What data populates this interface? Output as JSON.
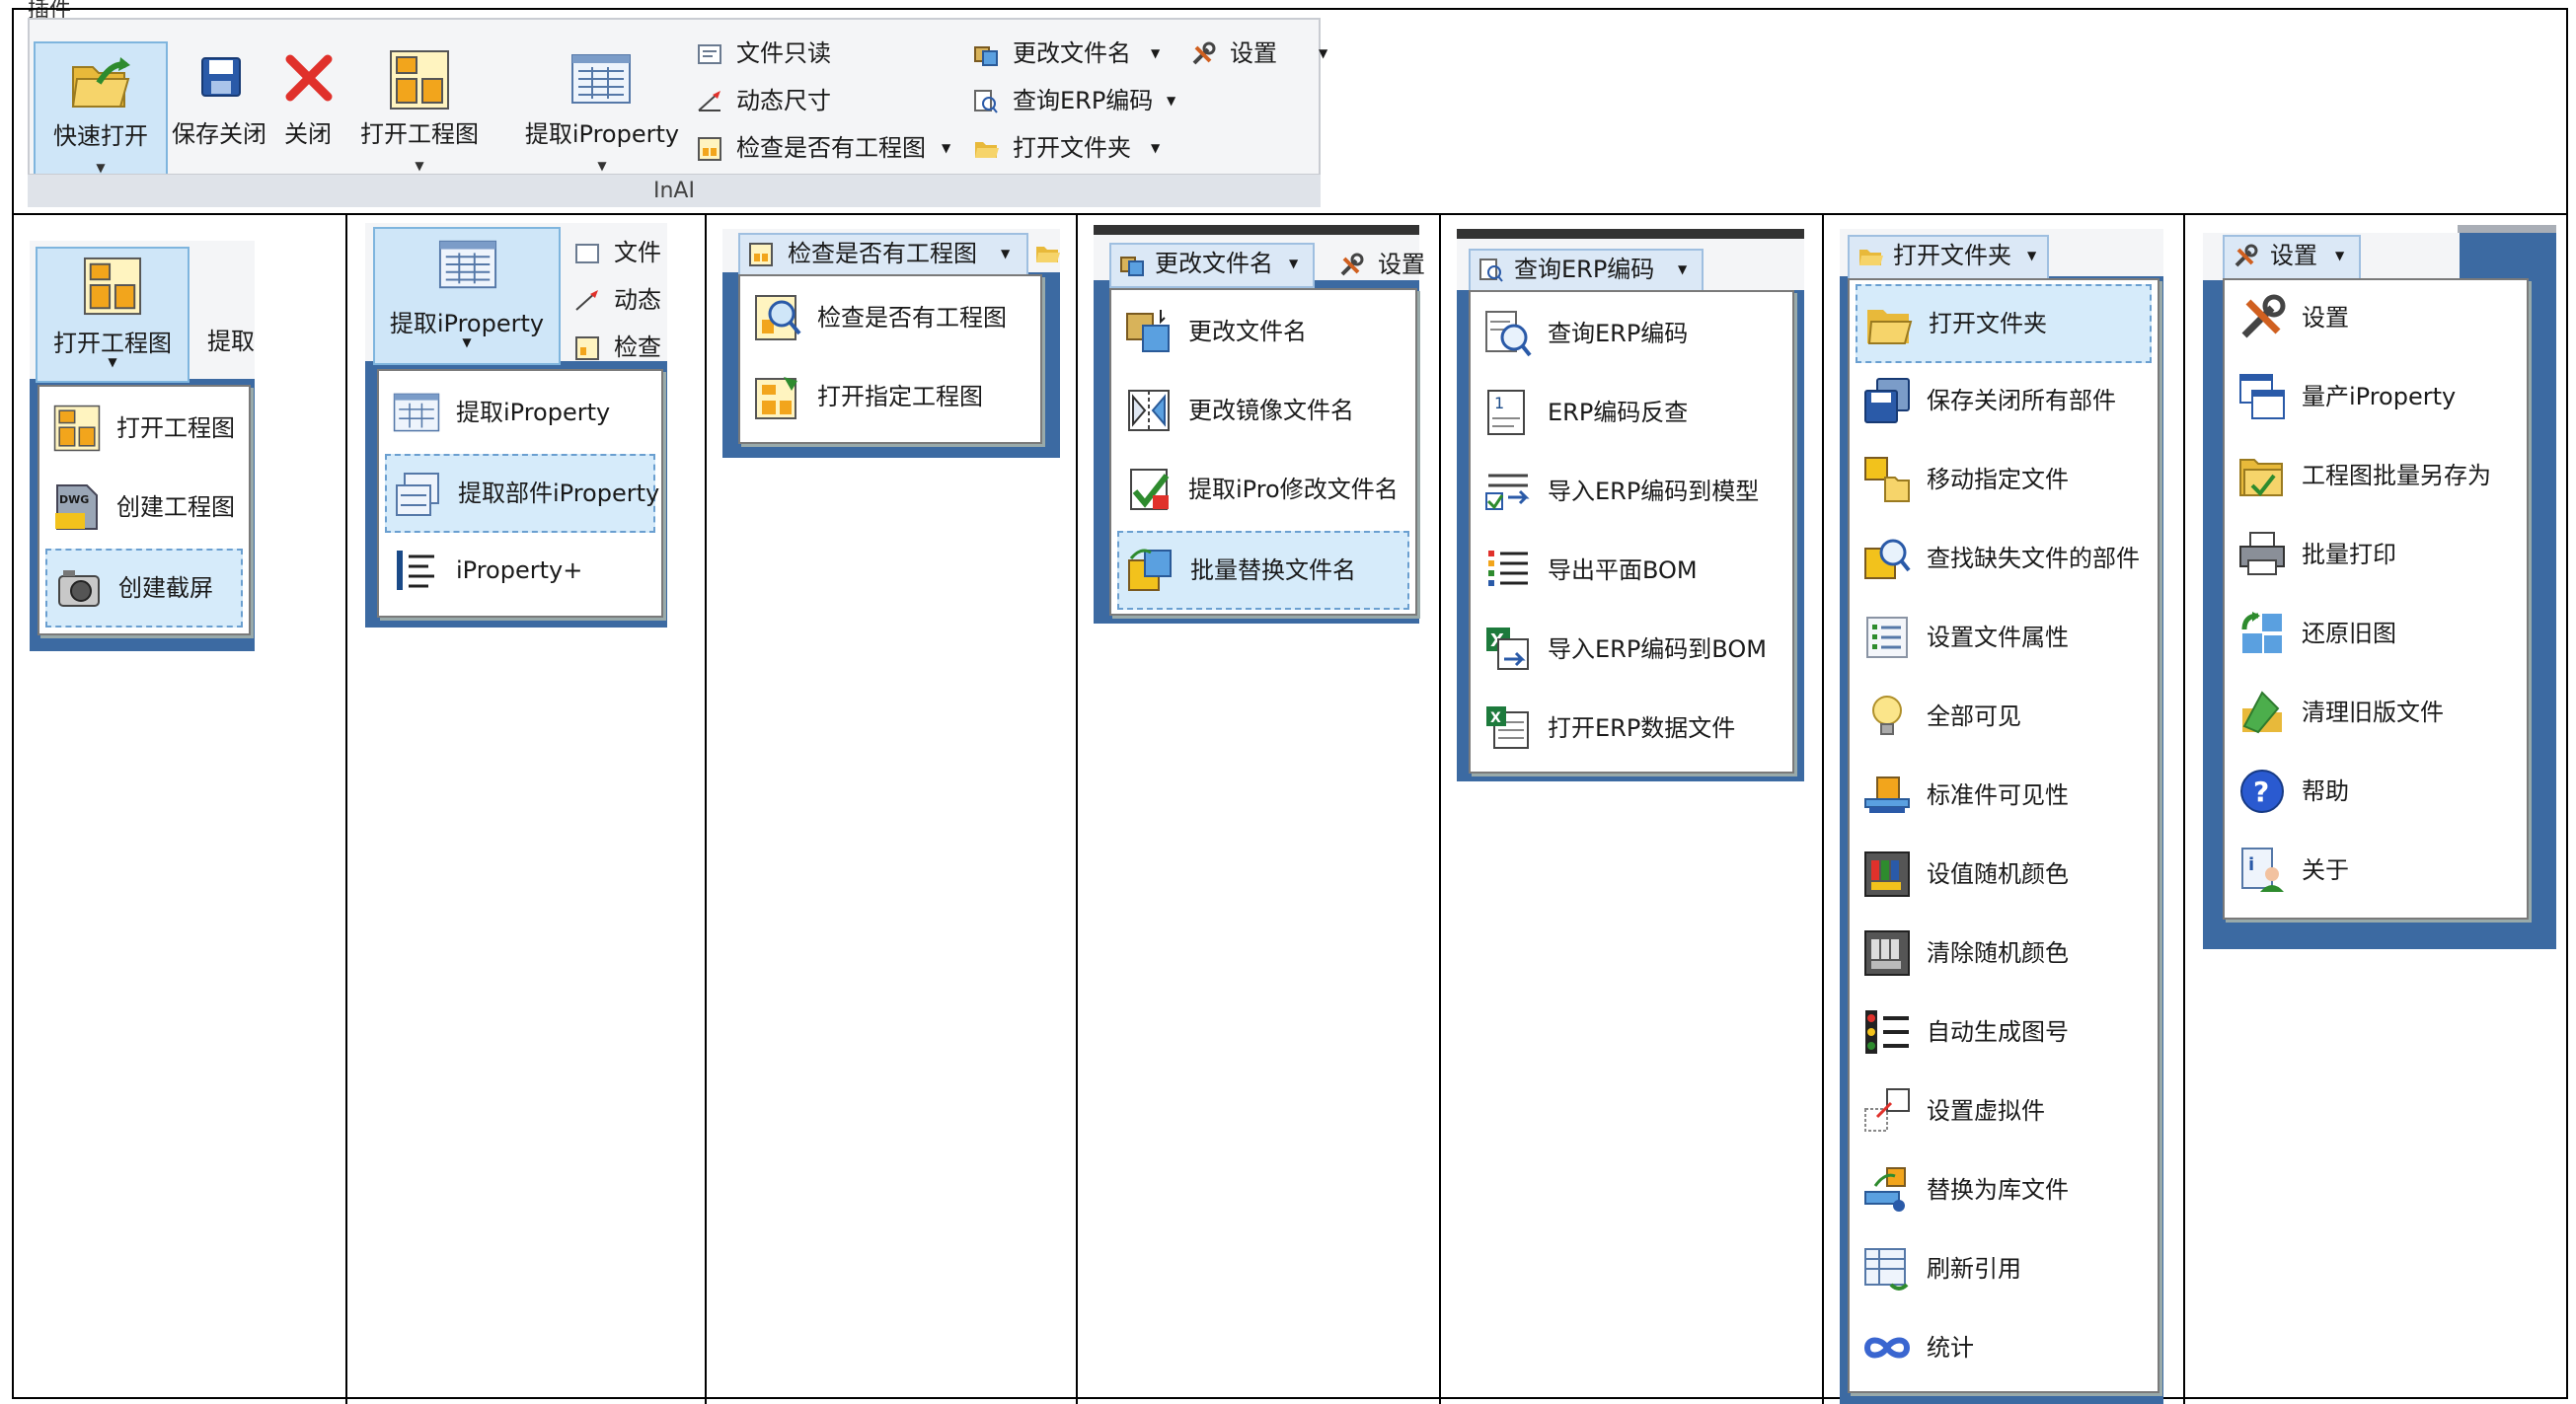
{
  "caption": "插件",
  "ribbon": {
    "group_label": "InAI",
    "quick_open": "快速打开",
    "save_close": "保存关闭",
    "close": "关闭",
    "open_drawing": "打开工程图",
    "extract_iproperty": "提取iProperty",
    "readonly": "文件只读",
    "dynamic_size": "动态尺寸",
    "check_drawing": "检查是否有工程图",
    "rename_file": "更改文件名",
    "query_erp": "查询ERP编码",
    "open_folder": "打开文件夹",
    "settings": "设置"
  },
  "panel1": {
    "head": "打开工程图",
    "side_label": "提取",
    "items": [
      "打开工程图",
      "创建工程图",
      "创建截屏"
    ],
    "dwg_badge": "DWG"
  },
  "panel2": {
    "head": "提取iProperty",
    "side": [
      "文件",
      "动态",
      "检查"
    ],
    "items": [
      "提取iProperty",
      "提取部件iProperty",
      "iProperty+"
    ]
  },
  "panel3": {
    "head": "检查是否有工程图",
    "items": [
      "检查是否有工程图",
      "打开指定工程图"
    ]
  },
  "panel4": {
    "head": "更改文件名",
    "side": "设置",
    "items": [
      "更改文件名",
      "更改镜像文件名",
      "提取iPro修改文件名",
      "批量替换文件名"
    ]
  },
  "panel5": {
    "head": "查询ERP编码",
    "items": [
      "查询ERP编码",
      "ERP编码反查",
      "导入ERP编码到模型",
      "导出平面BOM",
      "导入ERP编码到BOM",
      "打开ERP数据文件"
    ]
  },
  "panel6": {
    "head": "打开文件夹",
    "items": [
      "打开文件夹",
      "保存关闭所有部件",
      "移动指定文件",
      "查找缺失文件的部件",
      "设置文件属性",
      "全部可见",
      "标准件可见性",
      "设值随机颜色",
      "清除随机颜色",
      "自动生成图号",
      "设置虚拟件",
      "替换为库文件",
      "刷新引用",
      "统计"
    ]
  },
  "panel7": {
    "head": "设置",
    "items": [
      "设置",
      "量产iProperty",
      "工程图批量另存为",
      "批量打印",
      "还原旧图",
      "清理旧版文件",
      "帮助",
      "关于"
    ]
  }
}
